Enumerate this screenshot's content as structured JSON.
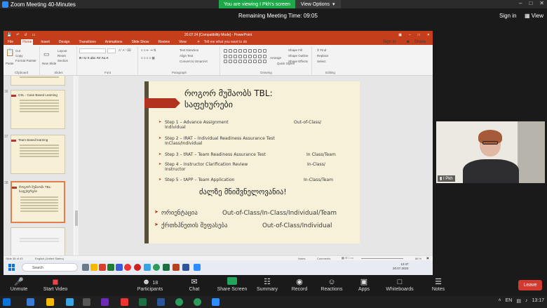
{
  "zoom": {
    "window_title": "Zoom Meeting 40-Minutes",
    "viewing_banner": "You are viewing I Pkh's screen",
    "view_options": "View Options",
    "remaining": "Remaining Meeting Time: 09:05",
    "sign_in": "Sign in",
    "view": "View",
    "participant_name": "I Pkh",
    "toolbar": {
      "unmute": "Unmute",
      "start_video": "Start Video",
      "participants": "Participants",
      "participants_count": "18",
      "chat": "Chat",
      "share_screen": "Share Screen",
      "summary": "Summary",
      "record": "Record",
      "reactions": "Reactions",
      "apps": "Apps",
      "whiteboards": "Whiteboards",
      "notes": "Notes",
      "leave": "Leave"
    }
  },
  "ppt": {
    "doc_title": "20.07.24 [Compatibility Mode] - PowerPoint",
    "tabs": [
      "File",
      "Home",
      "Insert",
      "Design",
      "Transitions",
      "Animations",
      "Slide Show",
      "Review",
      "View"
    ],
    "tell_me": "Tell me what you want to do",
    "sign_in": "Sign in",
    "share": "Share",
    "ribbon": {
      "clipboard": "Clipboard",
      "slides": "Slides",
      "font": "Font",
      "paragraph": "Paragraph",
      "drawing": "Drawing",
      "editing": "Editing",
      "paste": "Paste",
      "cut": "Cut",
      "copy": "Copy",
      "format_painter": "Format Painter",
      "new_slide": "New Slide",
      "layout": "Layout",
      "reset": "Reset",
      "section": "Section",
      "text_direction": "Text Direction",
      "align_text": "Align Text",
      "convert_smartart": "Convert to SmartArt",
      "arrange": "Arrange",
      "quick_styles": "Quick Styles",
      "shape_fill": "Shape Fill",
      "shape_outline": "Shape Outline",
      "shape_effects": "Shape Effects",
      "find": "Find",
      "replace": "Replace",
      "select": "Select"
    },
    "thumbnails": [
      {
        "num": "36",
        "title": "CSL - Case Based Learning"
      },
      {
        "num": "37",
        "title": "Team Based learning"
      },
      {
        "num": "38",
        "title": "როგორ მუშაობს TBL: საფეხურები"
      }
    ],
    "status": {
      "slide": "Slide 38 of 43",
      "lang": "English (United States)",
      "notes": "Notes",
      "comments": "Comments",
      "zoom": "86 %"
    },
    "taskbar": {
      "search": "Search",
      "time": "12:47",
      "date": "20.07.2024"
    }
  },
  "slide": {
    "title_line1": "როგორ მუშაობს TBL:",
    "title_line2": "საფეხურები",
    "steps": [
      {
        "text": "Step 1 – Advance Assignment",
        "cont": "Individual",
        "right": "Out-of-Class/"
      },
      {
        "text": "Step 2 – IRAT – Individual Readiness Assurance Test",
        "cont": "InClass/Individual",
        "right": ""
      },
      {
        "text": "Step 3 – tRAT – Team Readiness Assurance Test",
        "cont": "",
        "right": "In Class/Team"
      },
      {
        "text": "Step 4 – Instructor Clarification Review",
        "cont": "Instructor",
        "right": "In-Class/"
      },
      {
        "text": "Step 5 – tAPP – Team Application",
        "cont": "",
        "right": "In-Class/Team"
      }
    ],
    "emphasis": "ძალზე მნიშვნელოვანია!",
    "big_items": [
      {
        "left": "ორიენტაცია",
        "right": "Out-of-Class/In-Class/Individual/Team"
      },
      {
        "left": "ქრთხპნეთის შეფასება",
        "right": "Out-of-Class/Individual"
      }
    ]
  },
  "win": {
    "lang": "EN",
    "time": "13:17"
  }
}
